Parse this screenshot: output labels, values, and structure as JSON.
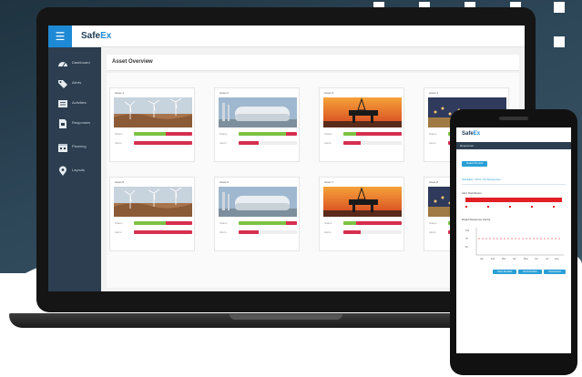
{
  "app": {
    "logo": {
      "text": "Safe",
      "accent": "Ex"
    },
    "menu_icon": "hamburger-icon"
  },
  "sidebar": {
    "items": [
      {
        "label": "Dashboard",
        "icon": "dashboard-icon"
      },
      {
        "label": "Alerts",
        "icon": "tag-icon"
      },
      {
        "label": "Activities",
        "icon": "list-icon"
      },
      {
        "label": "Responses",
        "icon": "document-icon"
      },
      {
        "label": "Planning",
        "icon": "calendar-icon"
      },
      {
        "label": "Layouts",
        "icon": "map-pin-icon"
      }
    ]
  },
  "main": {
    "title": "Asset Overview",
    "cards": [
      {
        "name": "Asset 1",
        "image": "wind-turbines",
        "bar1_label": "Status",
        "bar1_green": 0.55,
        "bar2_label": "Alerts",
        "bar2_red": 1.0
      },
      {
        "name": "Asset 2",
        "image": "gas-tanks",
        "bar1_label": "Status",
        "bar1_green": 0.82,
        "bar2_label": "Alerts",
        "bar2_red": 0.35
      },
      {
        "name": "Asset 3",
        "image": "oil-rig",
        "bar1_label": "Status",
        "bar1_green": 0.22,
        "bar2_label": "Alerts",
        "bar2_red": 0.3
      },
      {
        "name": "Asset 4",
        "image": "refinery",
        "bar1_label": "Status",
        "bar1_green": 0.5,
        "bar2_label": "Alerts",
        "bar2_red": 0.6
      },
      {
        "name": "Asset 5",
        "image": "wind-turbines",
        "bar1_label": "Status",
        "bar1_green": 0.55,
        "bar2_label": "Alerts",
        "bar2_red": 1.0
      },
      {
        "name": "Asset 6",
        "image": "gas-tanks",
        "bar1_label": "Status",
        "bar1_green": 0.82,
        "bar2_label": "Alerts",
        "bar2_red": 0.35
      },
      {
        "name": "Asset 7",
        "image": "oil-rig",
        "bar1_label": "Status",
        "bar1_green": 0.22,
        "bar2_label": "Alerts",
        "bar2_red": 0.3
      },
      {
        "name": "Asset 8",
        "image": "refinery",
        "bar1_label": "Status",
        "bar1_green": 0.5,
        "bar2_label": "Alerts",
        "bar2_red": 0.6
      }
    ]
  },
  "phone": {
    "logo": {
      "text": "Safe",
      "accent": "Ex"
    },
    "nav_label": "Responses",
    "filter_button": "Select Period",
    "section_title": "SAFEEX / 1701 / 32 Responses",
    "status_label": "Alert Distribution",
    "speed_label": "Rapid Response Factor",
    "y_ticks": [
      "100",
      "75",
      "50"
    ],
    "x_ticks": [
      "Jan",
      "Feb",
      "Mar",
      "Apr",
      "May",
      "Jun",
      "Jul",
      "Aug"
    ],
    "footer_buttons": [
      "View Details",
      "All Activities",
      "Download"
    ],
    "colors": {
      "accent": "#2a9fd6",
      "alert": "#e21f26"
    }
  },
  "colors": {
    "sidebar": "#2c3e50",
    "brand": "#1e8ad6",
    "status_green": "#7dc242",
    "alert_red": "#d62f4f"
  }
}
